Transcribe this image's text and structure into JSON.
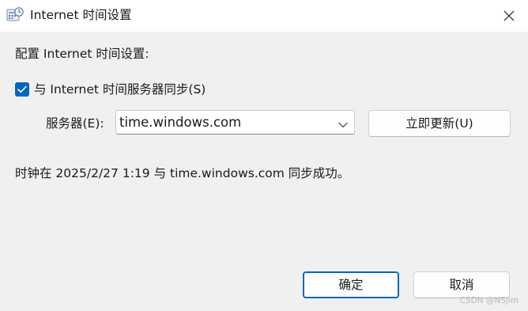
{
  "window": {
    "title": "Internet 时间设置",
    "icon": "control-panel-clock-icon"
  },
  "main": {
    "section_label": "配置 Internet 时间设置:",
    "sync_checkbox": {
      "label": "与 Internet 时间服务器同步(S)",
      "checked": true
    },
    "server_label": "服务器(E):",
    "server_value": "time.windows.com",
    "update_button": "立即更新(U)",
    "status": "时钟在 2025/2/27 1:19 与 time.windows.com 同步成功。"
  },
  "footer": {
    "ok_button": "确定",
    "cancel_button": "取消"
  },
  "watermark": "CSDN @NSjim",
  "colors": {
    "accent": "#0067c0",
    "background": "#f0f0f0",
    "titlebar": "#ffffff"
  }
}
